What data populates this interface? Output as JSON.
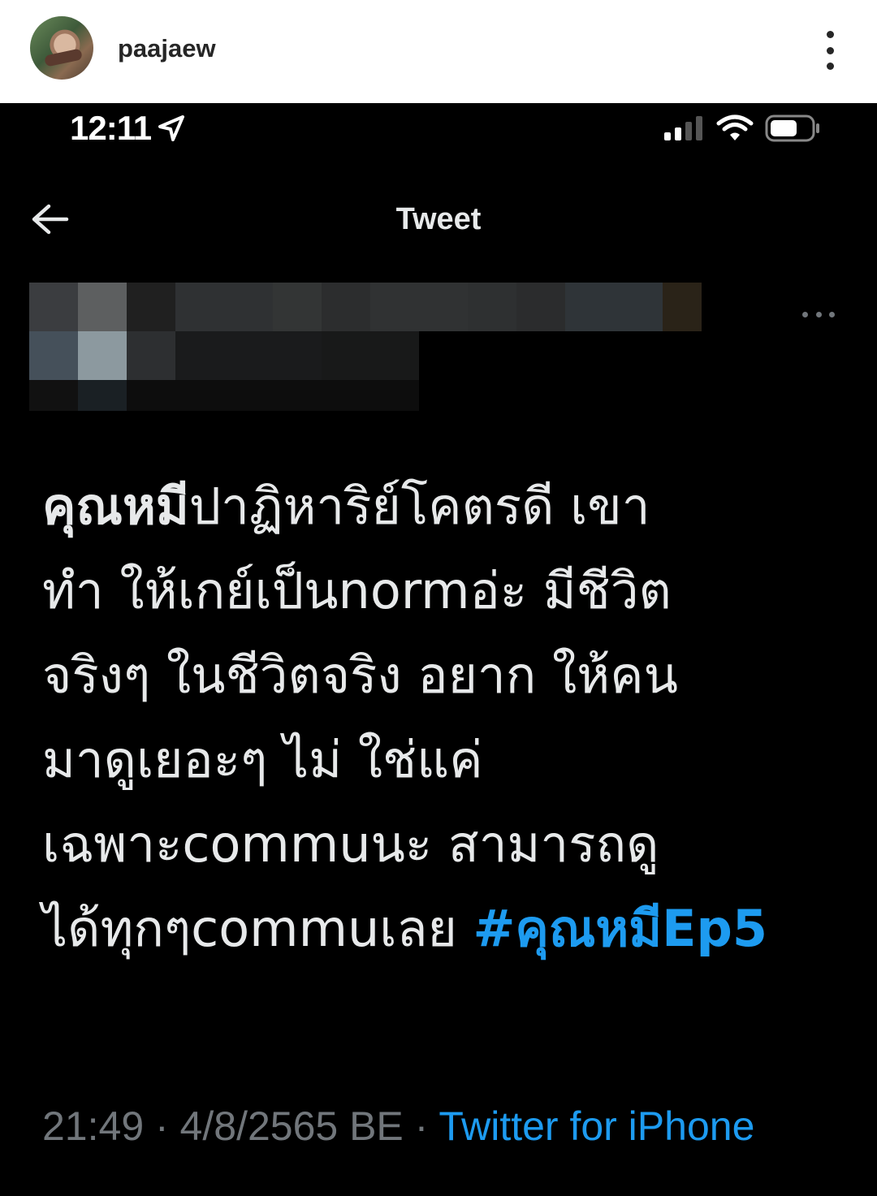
{
  "instagram": {
    "username": "paajaew",
    "avatar_icon": "profile-avatar",
    "more_icon": "vertical-ellipsis-icon"
  },
  "status_bar": {
    "time": "12:11",
    "location_icon": "location-arrow-icon",
    "signal_icon": "cellular-signal-icon",
    "wifi_icon": "wifi-icon",
    "battery_icon": "battery-icon"
  },
  "twitter_nav": {
    "title": "Tweet",
    "back_icon": "back-arrow-icon"
  },
  "tweet": {
    "more_icon": "horizontal-ellipsis-icon",
    "author_bold": "คุณหมี",
    "text_line1_rest": "ปาฏิหาริย์โคตรดี เขา",
    "text_rest": "ทำ ให้เกย์เป็นnormอ่ะ มีชีวิต\nจริงๆ  ในชีวิตจริง อยาก ให้คน\nมาดูเยอะๆ ไม่ ใช่แค่\nเฉพาะcommuนะ สามารถดู\nได้ทุกๆcommuเลย ",
    "hashtag": "#คุณหมีEp5",
    "timestamp": "21:49 · 4/8/2565 BE · ",
    "source": "Twitter for iPhone"
  },
  "colors": {
    "background": "#000000",
    "text": "#e7e9ea",
    "muted": "#71767b",
    "link": "#1d9bf0"
  }
}
